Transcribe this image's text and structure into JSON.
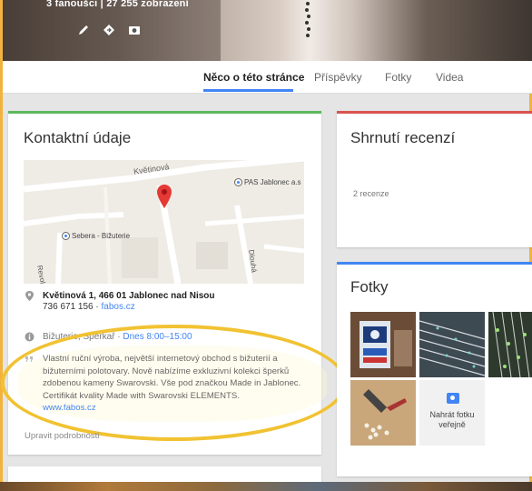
{
  "cover": {
    "stats": "3 fanoušci | 27 255 zobrazení",
    "icons": [
      "pencil-icon",
      "diamond-icon",
      "camera-icon"
    ]
  },
  "tabs": [
    {
      "label": "Něco o této stránce",
      "active": true
    },
    {
      "label": "Příspěvky",
      "active": false
    },
    {
      "label": "Fotky",
      "active": false
    },
    {
      "label": "Videa",
      "active": false
    }
  ],
  "contact": {
    "title": "Kontaktní údaje",
    "map": {
      "street1": "Květinová",
      "place1": "PAS Jablonec a.s",
      "place2": "Sebera - Bižuterie",
      "street2": "Revoluční",
      "street3": "Dlouhá"
    },
    "address": "Květinová 1, 466 01 Jablonec nad Nisou",
    "phone": "736 671 156 · ",
    "website": "fabos.cz",
    "category": "Bižuterie, Sperkař · ",
    "hours": "Dnes 8:00–15:00",
    "description": "Vlastní ruční výroba, největší internetový obchod s bižuterií a bižuterními polotovary. Nově nabízíme exkluzivní kolekci šperků zdobenou kameny Swarovski. Vše pod značkou Made in Jablonec. Certifikát kvality Made with Swarovski ELEMENTS.",
    "description_link": "www.fabos.cz",
    "edit_label": "Upravit podrobnosti"
  },
  "reviews": {
    "title": "Shrnutí recenzí",
    "count": "2 recenze"
  },
  "photos": {
    "title": "Fotky",
    "upload_label": "Nahrát fotku veřejně"
  },
  "colors": {
    "accent": "#4285f4",
    "green": "#5cb85c",
    "red": "#d9534f",
    "highlight": "#f1c232"
  }
}
